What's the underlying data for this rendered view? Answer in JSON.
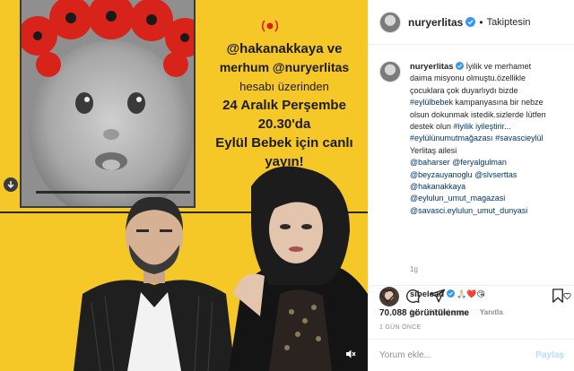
{
  "post": {
    "username": "nuryerlitas",
    "follow_state": "Takiptesin",
    "dot": "•"
  },
  "media": {
    "headline": {
      "line1": "@hakanakkaya ve",
      "line2": "merhum @nuryerlitas",
      "line3": "hesabı üzerinden",
      "line4": "24 Aralık Perşembe",
      "line5": "20.30'da",
      "line6": "Eylül Bebek için canlı yayın!"
    },
    "colors": {
      "background": "#f5c727",
      "flowers": "#d8231b"
    },
    "icons": {
      "live": "live-broadcast-icon",
      "sound": "volume-mute-icon",
      "download": "download-icon"
    }
  },
  "caption": {
    "username": "nuryerlitas",
    "lines": [
      {
        "parts": [
          {
            "t": "İyilik ve merhamet"
          }
        ]
      },
      {
        "parts": [
          {
            "t": "daima misyonu olmuştu.özellikle"
          }
        ]
      },
      {
        "parts": [
          {
            "t": "çocuklara çok duyarlıydı bizde"
          }
        ]
      },
      {
        "parts": [
          {
            "t": "#eylülbebek",
            "link": true
          },
          {
            "t": " kampanyasına bir nebze"
          }
        ]
      },
      {
        "parts": [
          {
            "t": "olsun dokunmak istedik.sizlerde lütfen"
          }
        ]
      },
      {
        "parts": [
          {
            "t": "destek olun "
          },
          {
            "t": "#iyilik",
            "link": true
          },
          {
            "t": " "
          },
          {
            "t": "iyileştirir...",
            "link": true
          }
        ]
      },
      {
        "parts": [
          {
            "t": "#eylülünumutmağazası",
            "link": true
          },
          {
            "t": " "
          },
          {
            "t": "#savascieylül",
            "link": true
          }
        ]
      },
      {
        "parts": [
          {
            "t": "Yerlitaş ailesi"
          }
        ]
      },
      {
        "parts": [
          {
            "t": "@baharser",
            "link": true
          },
          {
            "t": " "
          },
          {
            "t": "@feryalgulman",
            "link": true
          }
        ]
      },
      {
        "parts": [
          {
            "t": "@beyzauyanoglu",
            "link": true
          },
          {
            "t": " "
          },
          {
            "t": "@slvserttas",
            "link": true
          }
        ]
      },
      {
        "parts": [
          {
            "t": "@hakanakkaya",
            "link": true
          }
        ]
      },
      {
        "parts": [
          {
            "t": "@eylulun_umut_magazasi",
            "link": true
          }
        ]
      },
      {
        "parts": [
          {
            "t": "@savasci.eylulun_umut_dunyasi",
            "link": true
          }
        ]
      }
    ],
    "time": "1g"
  },
  "comment": {
    "username": "sibelcan",
    "text": "🙏🏻❤️😘",
    "time": "1g",
    "likes": "52 beğenme",
    "reply": "Yanıtla"
  },
  "stats": {
    "views": "70.088 görüntülenme",
    "time_ago": "1 GÜN ÖNCE"
  },
  "add_comment": {
    "placeholder": "Yorum ekle...",
    "post_label": "Paylaş"
  }
}
